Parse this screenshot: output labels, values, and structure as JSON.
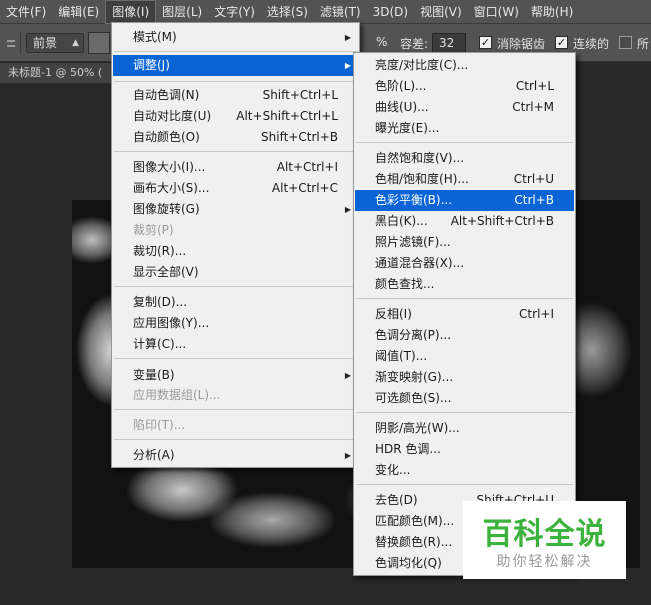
{
  "menubar": {
    "items": [
      "文件(F)",
      "编辑(E)",
      "图像(I)",
      "图层(L)",
      "文字(Y)",
      "选择(S)",
      "滤镜(T)",
      "3D(D)",
      "视图(V)",
      "窗口(W)",
      "帮助(H)"
    ],
    "active_index": 2
  },
  "optionsbar": {
    "preset_value": "前景",
    "percent_suffix": "%",
    "tolerance_label": "容差:",
    "tolerance_value": "32",
    "antialias_label": "消除锯齿",
    "contiguous_label": "连续的",
    "all_layers_label": "所"
  },
  "document_tab": {
    "title": "未标题-1 @ 50% ("
  },
  "image_menu": {
    "items": [
      {
        "label": "模式(M)",
        "shortcut": "",
        "submenu": true,
        "disabled": false
      },
      {
        "label": "调整(J)",
        "shortcut": "",
        "submenu": true,
        "disabled": false,
        "highlighted": true
      },
      {
        "label": "自动色调(N)",
        "shortcut": "Shift+Ctrl+L"
      },
      {
        "label": "自动对比度(U)",
        "shortcut": "Alt+Shift+Ctrl+L"
      },
      {
        "label": "自动颜色(O)",
        "shortcut": "Shift+Ctrl+B"
      },
      {
        "label": "图像大小(I)...",
        "shortcut": "Alt+Ctrl+I"
      },
      {
        "label": "画布大小(S)...",
        "shortcut": "Alt+Ctrl+C"
      },
      {
        "label": "图像旋转(G)",
        "shortcut": "",
        "submenu": true
      },
      {
        "label": "裁剪(P)",
        "shortcut": "",
        "disabled": true
      },
      {
        "label": "裁切(R)...",
        "shortcut": ""
      },
      {
        "label": "显示全部(V)",
        "shortcut": ""
      },
      {
        "label": "复制(D)...",
        "shortcut": ""
      },
      {
        "label": "应用图像(Y)...",
        "shortcut": ""
      },
      {
        "label": "计算(C)...",
        "shortcut": ""
      },
      {
        "label": "变量(B)",
        "shortcut": "",
        "submenu": true
      },
      {
        "label": "应用数据组(L)...",
        "shortcut": "",
        "disabled": true
      },
      {
        "label": "陷印(T)...",
        "shortcut": "",
        "disabled": true
      },
      {
        "label": "分析(A)",
        "shortcut": "",
        "submenu": true
      }
    ]
  },
  "adjust_menu": {
    "items": [
      {
        "label": "亮度/对比度(C)...",
        "shortcut": ""
      },
      {
        "label": "色阶(L)...",
        "shortcut": "Ctrl+L"
      },
      {
        "label": "曲线(U)...",
        "shortcut": "Ctrl+M"
      },
      {
        "label": "曝光度(E)...",
        "shortcut": ""
      },
      {
        "label": "自然饱和度(V)...",
        "shortcut": ""
      },
      {
        "label": "色相/饱和度(H)...",
        "shortcut": "Ctrl+U"
      },
      {
        "label": "色彩平衡(B)...",
        "shortcut": "Ctrl+B",
        "highlighted": true
      },
      {
        "label": "黑白(K)...",
        "shortcut": "Alt+Shift+Ctrl+B"
      },
      {
        "label": "照片滤镜(F)...",
        "shortcut": ""
      },
      {
        "label": "通道混合器(X)...",
        "shortcut": ""
      },
      {
        "label": "颜色查找...",
        "shortcut": ""
      },
      {
        "label": "反相(I)",
        "shortcut": "Ctrl+I"
      },
      {
        "label": "色调分离(P)...",
        "shortcut": ""
      },
      {
        "label": "阈值(T)...",
        "shortcut": ""
      },
      {
        "label": "渐变映射(G)...",
        "shortcut": ""
      },
      {
        "label": "可选颜色(S)...",
        "shortcut": ""
      },
      {
        "label": "阴影/高光(W)...",
        "shortcut": ""
      },
      {
        "label": "HDR 色调...",
        "shortcut": ""
      },
      {
        "label": "变化...",
        "shortcut": ""
      },
      {
        "label": "去色(D)",
        "shortcut": "Shift+Ctrl+U"
      },
      {
        "label": "匹配颜色(M)...",
        "shortcut": ""
      },
      {
        "label": "替换颜色(R)...",
        "shortcut": ""
      },
      {
        "label": "色调均化(Q)",
        "shortcut": ""
      }
    ]
  },
  "watermark": {
    "title": "百科全说",
    "subtitle": "助你轻松解决"
  },
  "colors": {
    "highlight": "#0a64d6",
    "menu_bg": "#f0f0f0",
    "chrome": "#535353",
    "watermark_green": "#3bb33d"
  }
}
